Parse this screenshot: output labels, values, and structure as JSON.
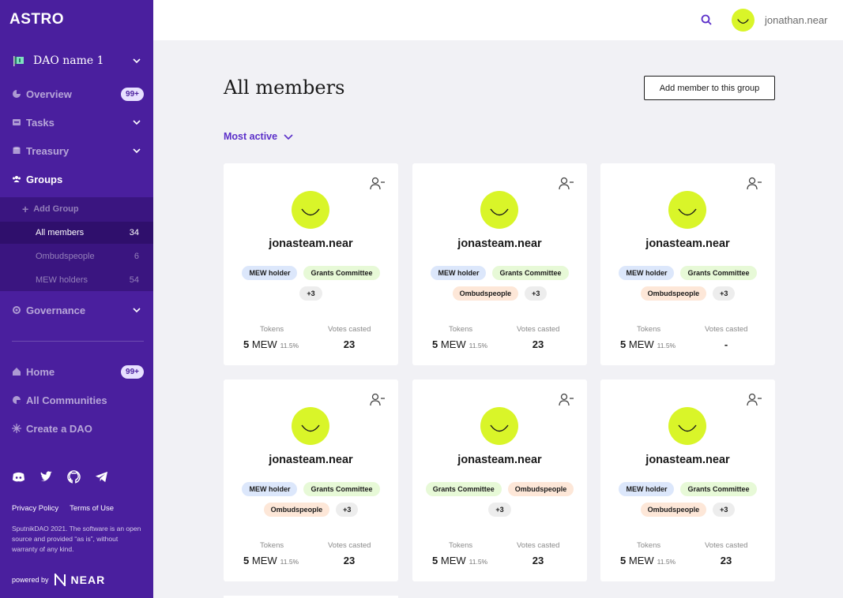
{
  "sidebar": {
    "logo": "ASTRO",
    "dao_name": "DAO name 1",
    "nav": [
      {
        "label": "Overview",
        "badge": "99+"
      },
      {
        "label": "Tasks"
      },
      {
        "label": "Treasury"
      },
      {
        "label": "Groups"
      }
    ],
    "groups_sub": {
      "add_group": "Add Group",
      "items": [
        {
          "label": "All members",
          "count": "34"
        },
        {
          "label": "Ombudspeople",
          "count": "6"
        },
        {
          "label": "MEW holders",
          "count": "54"
        }
      ]
    },
    "governance": "Governance",
    "nav2": [
      {
        "label": "Home",
        "badge": "99+"
      },
      {
        "label": "All Communities"
      },
      {
        "label": "Create a DAO"
      }
    ],
    "privacy": "Privacy Policy",
    "terms": "Terms of Use",
    "copyright": "SputnikDAO 2021. The software is an open source and provided “as is”, without warranty of any kind.",
    "powered_by": "powered by",
    "near": "NEAR"
  },
  "header": {
    "username": "jonathan.near"
  },
  "main": {
    "title": "All members",
    "add_member": "Add member to this group",
    "sort": "Most active",
    "tokens_label": "Tokens",
    "votes_label": "Votes casted",
    "cards": [
      {
        "name": "jonasteam.near",
        "tags": [
          {
            "t": "MEW holder",
            "c": "blue"
          },
          {
            "t": "Grants Committee",
            "c": "green"
          },
          {
            "t": "+3",
            "c": "gray"
          }
        ],
        "tokens": "5",
        "token_unit": "MEW",
        "pct": "11.5%",
        "votes": "23"
      },
      {
        "name": "jonasteam.near",
        "tags": [
          {
            "t": "MEW holder",
            "c": "blue"
          },
          {
            "t": "Grants Committee",
            "c": "green"
          },
          {
            "t": "Ombudspeople",
            "c": "orange"
          },
          {
            "t": "+3",
            "c": "gray"
          }
        ],
        "tokens": "5",
        "token_unit": "MEW",
        "pct": "11.5%",
        "votes": "23"
      },
      {
        "name": "jonasteam.near",
        "tags": [
          {
            "t": "MEW holder",
            "c": "blue"
          },
          {
            "t": "Grants Committee",
            "c": "green"
          },
          {
            "t": "Ombudspeople",
            "c": "orange"
          },
          {
            "t": "+3",
            "c": "gray"
          }
        ],
        "tokens": "5",
        "token_unit": "MEW",
        "pct": "11.5%",
        "votes": "-"
      },
      {
        "name": "jonasteam.near",
        "tags": [
          {
            "t": "MEW holder",
            "c": "blue"
          },
          {
            "t": "Grants Committee",
            "c": "green"
          },
          {
            "t": "Ombudspeople",
            "c": "orange"
          },
          {
            "t": "+3",
            "c": "gray"
          }
        ],
        "tokens": "5",
        "token_unit": "MEW",
        "pct": "11.5%",
        "votes": "23"
      },
      {
        "name": "jonasteam.near",
        "tags": [
          {
            "t": "Grants Committee",
            "c": "green"
          },
          {
            "t": "Ombudspeople",
            "c": "orange"
          },
          {
            "t": "+3",
            "c": "gray"
          }
        ],
        "tokens": "5",
        "token_unit": "MEW",
        "pct": "11.5%",
        "votes": "23"
      },
      {
        "name": "jonasteam.near",
        "tags": [
          {
            "t": "MEW holder",
            "c": "blue"
          },
          {
            "t": "Grants Committee",
            "c": "green"
          },
          {
            "t": "Ombudspeople",
            "c": "orange"
          },
          {
            "t": "+3",
            "c": "gray"
          }
        ],
        "tokens": "5",
        "token_unit": "MEW",
        "pct": "11.5%",
        "votes": "23"
      }
    ]
  },
  "colors": {
    "sidebar": "#4a1f9e",
    "accent": "#5b2fc9",
    "avatar": "#d9f529"
  }
}
